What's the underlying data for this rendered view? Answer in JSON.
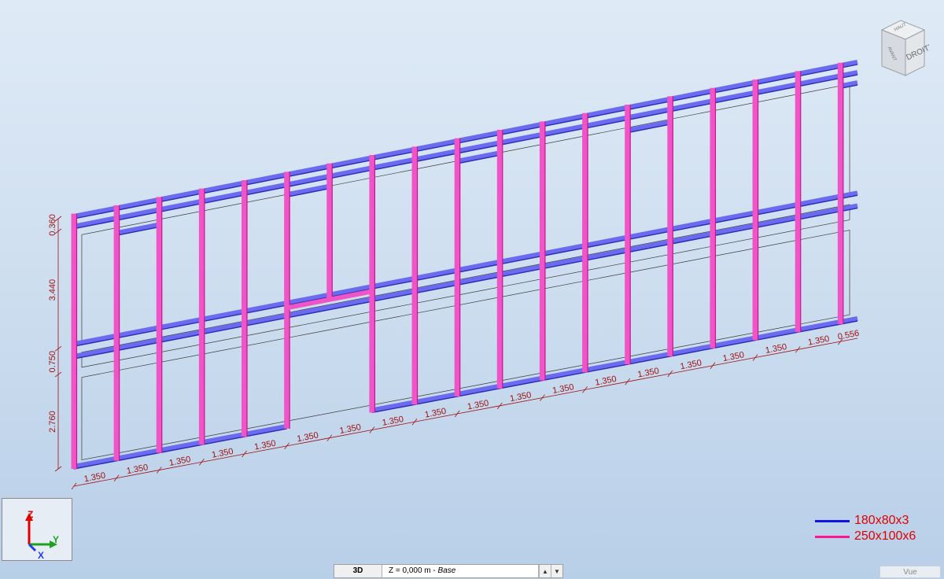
{
  "view_cube": {
    "face_label": "DROITE",
    "top_label": "HAUT",
    "side_label": "AVANT"
  },
  "axis_widget": {
    "z_label": "Z",
    "y_label": "Y",
    "x_label": "X"
  },
  "legend": [
    {
      "label": "180x80x3",
      "color": "#1414e0"
    },
    {
      "label": "250x100x6",
      "color": "#ff1493"
    }
  ],
  "colors": {
    "beam_fill": "#6b6bf0",
    "beam_edge": "#2a2ab5",
    "column_fill": "#f055c8",
    "column_edge": "#c8148c",
    "dimension": "#a01010",
    "panel_outline": "#3b3b3b"
  },
  "bottom_bar": {
    "view_mode": "3D",
    "plane_prefix": "Z = 0,000 m - ",
    "plane_name": "Base",
    "vue_label": "Vue"
  },
  "dimensions": {
    "horizontal": [
      "1.350",
      "1.350",
      "1.350",
      "1.350",
      "1.350",
      "1.350",
      "1.350",
      "1.350",
      "1.350",
      "1.350",
      "1.350",
      "1.350",
      "1.350",
      "1.350",
      "1.350",
      "1.350",
      "1.350",
      "1.350",
      "0.556"
    ],
    "vertical": [
      "2.760",
      "0.750",
      "3.440",
      "0.360"
    ]
  }
}
